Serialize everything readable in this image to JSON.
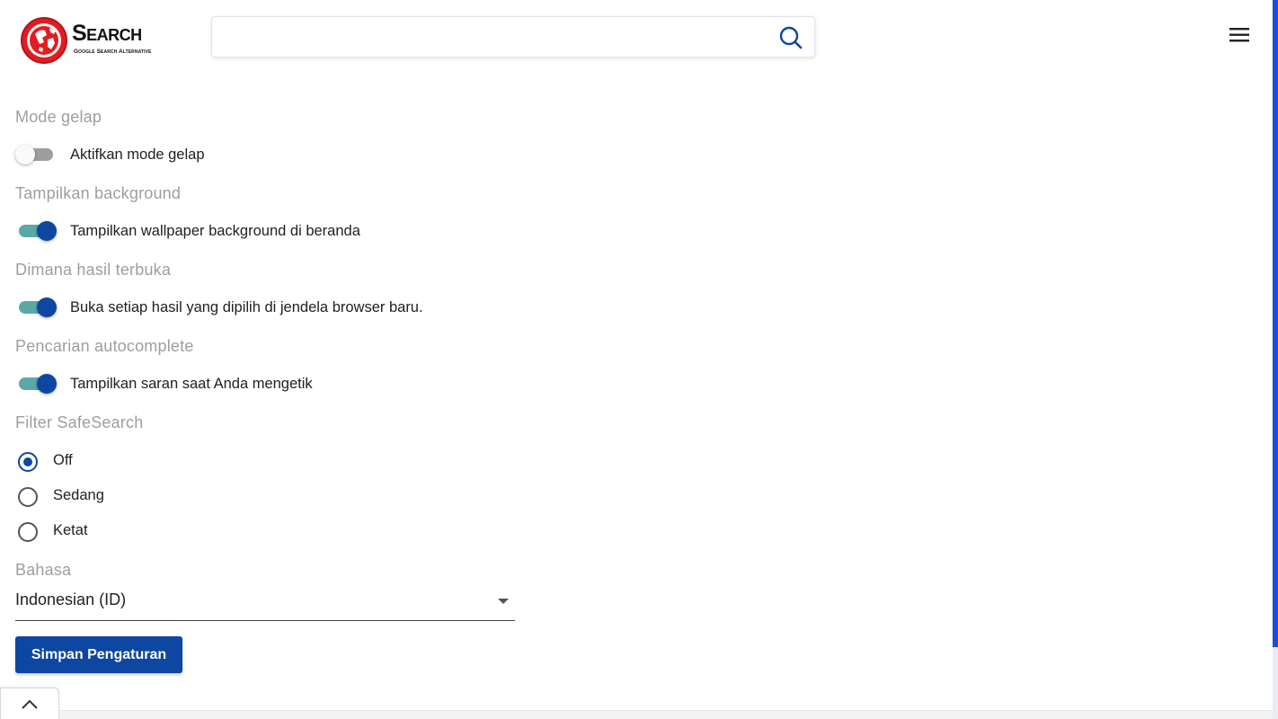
{
  "brand": {
    "name": "Search",
    "tagline": "Google Search Alternative"
  },
  "search": {
    "value": "",
    "placeholder": ""
  },
  "settings": {
    "dark_mode": {
      "title": "Mode gelap",
      "label": "Aktifkan mode gelap",
      "enabled": false
    },
    "background": {
      "title": "Tampilkan background",
      "label": "Tampilkan wallpaper background di beranda",
      "enabled": true
    },
    "results_open": {
      "title": "Dimana hasil terbuka",
      "label": "Buka setiap hasil yang dipilih di jendela browser baru.",
      "enabled": true
    },
    "autocomplete": {
      "title": "Pencarian autocomplete",
      "label": "Tampilkan saran saat Anda mengetik",
      "enabled": true
    },
    "safesearch": {
      "title": "Filter SafeSearch",
      "options": [
        "Off",
        "Sedang",
        "Ketat"
      ],
      "selected": "Off"
    },
    "language": {
      "title": "Bahasa",
      "selected": "Indonesian (ID)"
    }
  },
  "actions": {
    "save_label": "Simpan Pengaturan"
  },
  "colors": {
    "primary": "#0d47a1",
    "toggle_track_on": "#5aa9a7",
    "toggle_track_off": "#9e9e9e",
    "section_title": "#9e9e9e",
    "logo_red": "#e11d22"
  },
  "icons": {
    "search": "search-icon",
    "menu": "hamburger-menu-icon",
    "back_to_top": "chevron-up-icon",
    "logo": "globe-logo-icon"
  }
}
